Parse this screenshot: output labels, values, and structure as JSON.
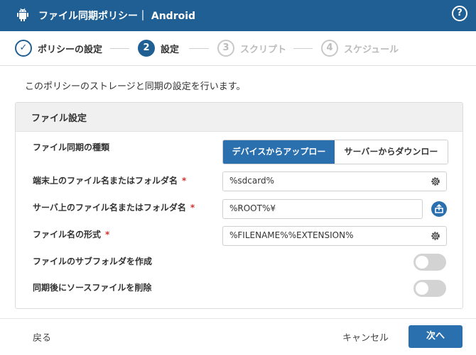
{
  "header": {
    "title": "ファイル同期ポリシー｜ Android",
    "help_icon": "?"
  },
  "steps": [
    {
      "number": "✓",
      "label": "ポリシーの設定"
    },
    {
      "number": "2",
      "label": "設定"
    },
    {
      "number": "3",
      "label": "スクリプト"
    },
    {
      "number": "4",
      "label": "スケジュール"
    }
  ],
  "description": "このポリシーのストレージと同期の設定を行います。",
  "panel": {
    "title": "ファイル設定",
    "sync_type": {
      "label": "ファイル同期の種類",
      "option_upload": "デバイスからアップロー",
      "option_download": "サーバーからダウンロー"
    },
    "device_path": {
      "label": "端末上のファイル名またはフォルダ名",
      "required": "*",
      "value": "%sdcard%"
    },
    "server_path": {
      "label": "サーバ上のファイル名またはフォルダ名",
      "required": "*",
      "value": "%ROOT%¥"
    },
    "filename_format": {
      "label": "ファイル名の形式",
      "required": "*",
      "value": "%FILENAME%%EXTENSION%"
    },
    "create_subfolder": {
      "label": "ファイルのサブフォルダを作成",
      "enabled": false
    },
    "delete_source": {
      "label": "同期後にソースファイルを削除",
      "enabled": false
    }
  },
  "footer": {
    "back": "戻る",
    "cancel": "キャンセル",
    "next": "次へ"
  },
  "colors": {
    "primary": "#1f5f93",
    "accent": "#2a6fae",
    "required": "#d0312d"
  }
}
